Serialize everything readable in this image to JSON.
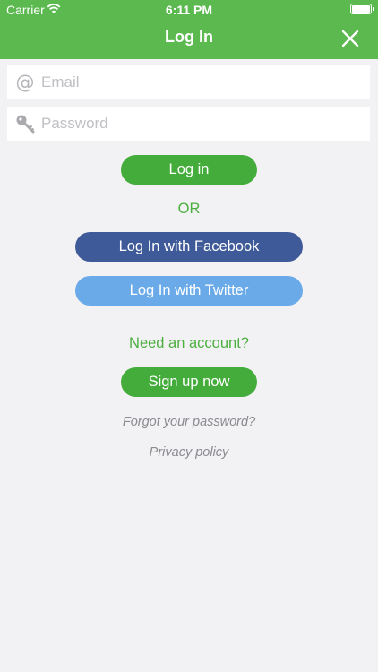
{
  "status_bar": {
    "carrier": "Carrier",
    "time": "6:11 PM"
  },
  "nav": {
    "title": "Log In",
    "close_icon": "close-icon"
  },
  "form": {
    "email_placeholder": "Email",
    "password_placeholder": "Password",
    "login_label": "Log in",
    "or_label": "OR",
    "facebook_label": "Log In with Facebook",
    "twitter_label": "Log In with Twitter",
    "need_account": "Need an account?",
    "signup_label": "Sign up now",
    "forgot_label": "Forgot your password?",
    "privacy_label": "Privacy policy"
  },
  "colors": {
    "primary": "#5bb94f",
    "button_green": "#44ac3b",
    "facebook": "#3f5a98",
    "twitter": "#6aaae8",
    "background": "#f2f2f5"
  }
}
